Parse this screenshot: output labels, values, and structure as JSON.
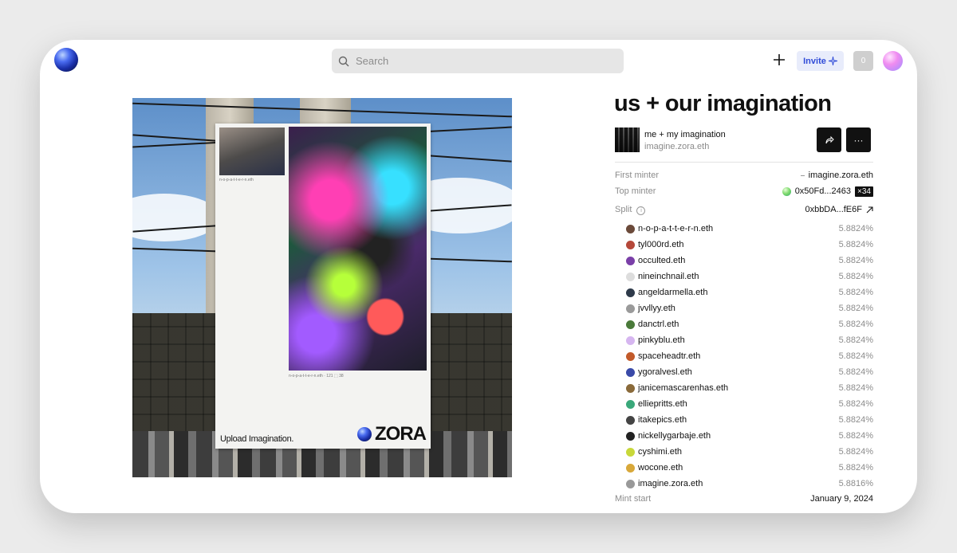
{
  "header": {
    "search_placeholder": "Search",
    "invite_label": "Invite",
    "notification_count": "0"
  },
  "artwork": {
    "poster_caption": "Upload Imagination.",
    "brand": "ZORA",
    "photo_meta": "n-o-p-a-t-t-e-r-n.eth",
    "art_meta": "n-o-p-a-t-t-e-r-n.eth  ·  121 ⬚ 38"
  },
  "token": {
    "title": "us + our imagination",
    "collection_name": "me + my imagination",
    "collection_creator": "imagine.zora.eth",
    "first_minter_label": "First minter",
    "first_minter_value": "imagine.zora.eth",
    "top_minter_label": "Top minter",
    "top_minter_value": "0x50Fd...2463",
    "top_minter_count": "×34",
    "split_label": "Split",
    "split_value": "0xbbDA...fE6F",
    "splits": [
      {
        "name": "n-o-p-a-t-t-e-r-n.eth",
        "pct": "5.8824%",
        "color": "#6b4a3a"
      },
      {
        "name": "tyl000rd.eth",
        "pct": "5.8824%",
        "color": "#b5483a"
      },
      {
        "name": "occulted.eth",
        "pct": "5.8824%",
        "color": "#7a3fa8"
      },
      {
        "name": "nineinchnail.eth",
        "pct": "5.8824%",
        "color": "#dddddd"
      },
      {
        "name": "angeldarmella.eth",
        "pct": "5.8824%",
        "color": "#2e3a4a"
      },
      {
        "name": "jvvllyy.eth",
        "pct": "5.8824%",
        "color": "#9a9a9a"
      },
      {
        "name": "danctrl.eth",
        "pct": "5.8824%",
        "color": "#4a7a3a"
      },
      {
        "name": "pinkyblu.eth",
        "pct": "5.8824%",
        "color": "#d6b6f0"
      },
      {
        "name": "spaceheadtr.eth",
        "pct": "5.8824%",
        "color": "#c25a2a"
      },
      {
        "name": "ygoralvesl.eth",
        "pct": "5.8824%",
        "color": "#3a4aa8"
      },
      {
        "name": "janicemascarenhas.eth",
        "pct": "5.8824%",
        "color": "#8a6a3a"
      },
      {
        "name": "elliepritts.eth",
        "pct": "5.8824%",
        "color": "#3aa87a"
      },
      {
        "name": "itakepics.eth",
        "pct": "5.8824%",
        "color": "#444444"
      },
      {
        "name": "nickellygarbaje.eth",
        "pct": "5.8824%",
        "color": "#222222"
      },
      {
        "name": "cyshimi.eth",
        "pct": "5.8824%",
        "color": "#c8d83a"
      },
      {
        "name": "wocone.eth",
        "pct": "5.8824%",
        "color": "#d8a83a"
      },
      {
        "name": "imagine.zora.eth",
        "pct": "5.8816%",
        "color": "#999999"
      }
    ],
    "mint_start_label": "Mint start",
    "mint_start_value": "January 9, 2024"
  }
}
